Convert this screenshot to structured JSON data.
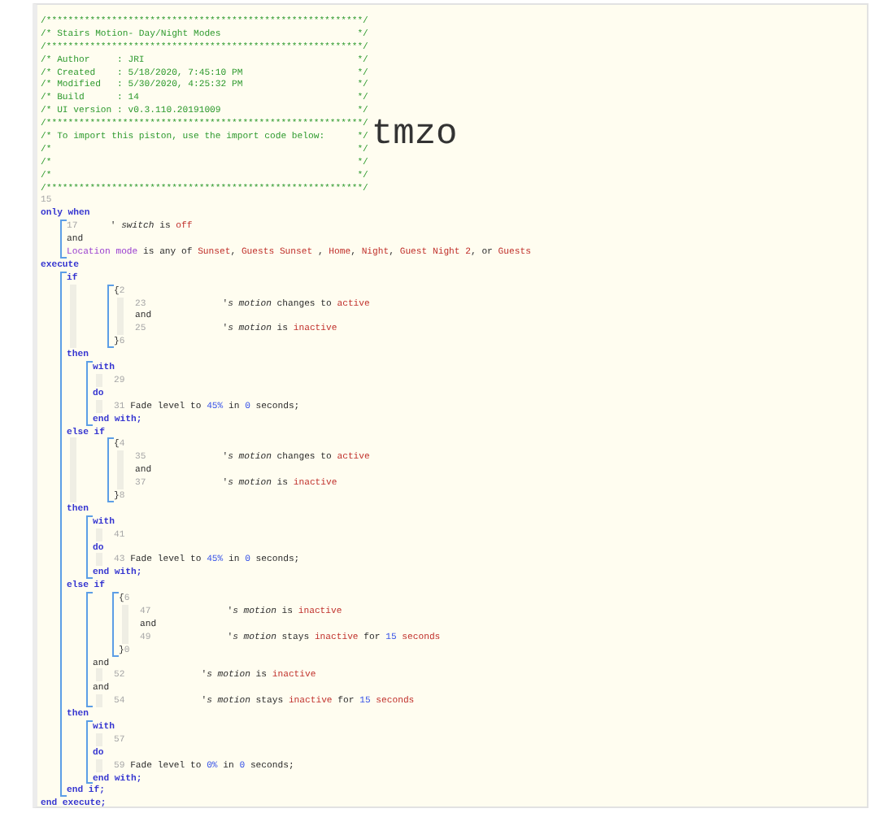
{
  "header": {
    "comment_lines": [
      "/**********************************************************/",
      "/* Stairs Motion- Day/Night Modes                         */",
      "/**********************************************************/",
      "/* Author     : JRI                                       */",
      "/* Created    : 5/18/2020, 7:45:10 PM                     */",
      "/* Modified   : 5/30/2020, 4:25:32 PM                     */",
      "/* Build      : 14                                        */",
      "/* UI version : v0.3.110.20191009                         */",
      "/**********************************************************/",
      "/* To import this piston, use the import code below:      */",
      "/*                                                        */",
      "/*                                                        */",
      "/*                                                        */",
      "/**********************************************************/"
    ],
    "import_code": "tmzo"
  },
  "code": [
    {
      "kind": "line",
      "tokens": [
        {
          "kind": "num",
          "text": "15"
        }
      ]
    },
    {
      "kind": "line",
      "tokens": [
        {
          "kind": "kw",
          "text": "only when"
        }
      ]
    },
    {
      "kind": "block",
      "items": [
        {
          "kind": "line",
          "tokens": [
            {
              "kind": "num",
              "text": "17"
            },
            {
              "kind": "txt",
              "text": "      ' *switch* is "
            },
            {
              "kind": "val",
              "text": "off"
            }
          ]
        },
        {
          "kind": "line",
          "tokens": [
            {
              "kind": "txt",
              "text": "and"
            }
          ]
        },
        {
          "kind": "line",
          "tokens": [
            {
              "kind": "var",
              "text": "Location mode"
            },
            {
              "kind": "txt",
              "text": " is any of "
            },
            {
              "kind": "val",
              "text": "Sunset"
            },
            {
              "kind": "txt",
              "text": ", "
            },
            {
              "kind": "val",
              "text": "Guests Sunset"
            },
            {
              "kind": "txt",
              "text": " , "
            },
            {
              "kind": "val",
              "text": "Home"
            },
            {
              "kind": "txt",
              "text": ", "
            },
            {
              "kind": "val",
              "text": "Night"
            },
            {
              "kind": "txt",
              "text": ", "
            },
            {
              "kind": "val",
              "text": "Guest Night 2"
            },
            {
              "kind": "txt",
              "text": ", or "
            },
            {
              "kind": "val",
              "text": "Guests"
            }
          ]
        }
      ]
    },
    {
      "kind": "line",
      "tokens": [
        {
          "kind": "kw",
          "text": "execute"
        }
      ]
    },
    {
      "kind": "block",
      "items": [
        {
          "kind": "line",
          "tokens": [
            {
              "kind": "kw",
              "text": "if"
            }
          ]
        },
        {
          "kind": "indent",
          "items": [
            {
              "kind": "block",
              "items": [
                {
                  "kind": "line",
                  "tokens": [
                    {
                      "kind": "txt",
                      "text": "{"
                    },
                    {
                      "kind": "num",
                      "text": "2"
                    }
                  ]
                },
                {
                  "kind": "indent",
                  "items": [
                    {
                      "kind": "line",
                      "tokens": [
                        {
                          "kind": "num",
                          "text": "23"
                        },
                        {
                          "kind": "txt",
                          "text": "              '*s motion* changes to "
                        },
                        {
                          "kind": "val",
                          "text": "active"
                        }
                      ]
                    },
                    {
                      "kind": "line",
                      "tokens": [
                        {
                          "kind": "txt",
                          "text": "and"
                        }
                      ]
                    },
                    {
                      "kind": "line",
                      "tokens": [
                        {
                          "kind": "num",
                          "text": "25"
                        },
                        {
                          "kind": "txt",
                          "text": "              '*s motion* is "
                        },
                        {
                          "kind": "val",
                          "text": "inactive"
                        }
                      ]
                    }
                  ]
                },
                {
                  "kind": "line",
                  "tokens": [
                    {
                      "kind": "txt",
                      "text": "}"
                    },
                    {
                      "kind": "num",
                      "text": "6"
                    }
                  ]
                }
              ]
            }
          ]
        },
        {
          "kind": "line",
          "tokens": [
            {
              "kind": "kw",
              "text": "then"
            }
          ]
        },
        {
          "kind": "block",
          "items": [
            {
              "kind": "line",
              "tokens": [
                {
                  "kind": "kw",
                  "text": "with"
                }
              ]
            },
            {
              "kind": "indent",
              "items": [
                {
                  "kind": "line",
                  "tokens": [
                    {
                      "kind": "num",
                      "text": "29"
                    }
                  ]
                }
              ]
            },
            {
              "kind": "line",
              "tokens": [
                {
                  "kind": "kw",
                  "text": "do"
                }
              ]
            },
            {
              "kind": "indent",
              "items": [
                {
                  "kind": "line",
                  "tokens": [
                    {
                      "kind": "num",
                      "text": "31"
                    },
                    {
                      "kind": "txt",
                      "text": " Fade level to "
                    },
                    {
                      "kind": "lit",
                      "text": "45%"
                    },
                    {
                      "kind": "txt",
                      "text": " in "
                    },
                    {
                      "kind": "lit",
                      "text": "0"
                    },
                    {
                      "kind": "txt",
                      "text": " seconds;"
                    }
                  ]
                }
              ]
            },
            {
              "kind": "line",
              "tokens": [
                {
                  "kind": "kw",
                  "text": "end with;"
                }
              ]
            }
          ]
        },
        {
          "kind": "line",
          "tokens": [
            {
              "kind": "kw",
              "text": "else if"
            }
          ]
        },
        {
          "kind": "indent",
          "items": [
            {
              "kind": "block",
              "items": [
                {
                  "kind": "line",
                  "tokens": [
                    {
                      "kind": "txt",
                      "text": "{"
                    },
                    {
                      "kind": "num",
                      "text": "4"
                    }
                  ]
                },
                {
                  "kind": "indent",
                  "items": [
                    {
                      "kind": "line",
                      "tokens": [
                        {
                          "kind": "num",
                          "text": "35"
                        },
                        {
                          "kind": "txt",
                          "text": "              '*s motion* changes to "
                        },
                        {
                          "kind": "val",
                          "text": "active"
                        }
                      ]
                    },
                    {
                      "kind": "line",
                      "tokens": [
                        {
                          "kind": "txt",
                          "text": "and"
                        }
                      ]
                    },
                    {
                      "kind": "line",
                      "tokens": [
                        {
                          "kind": "num",
                          "text": "37"
                        },
                        {
                          "kind": "txt",
                          "text": "              '*s motion* is "
                        },
                        {
                          "kind": "val",
                          "text": "inactive"
                        }
                      ]
                    }
                  ]
                },
                {
                  "kind": "line",
                  "tokens": [
                    {
                      "kind": "txt",
                      "text": "}"
                    },
                    {
                      "kind": "num",
                      "text": "8"
                    }
                  ]
                }
              ]
            }
          ]
        },
        {
          "kind": "line",
          "tokens": [
            {
              "kind": "kw",
              "text": "then"
            }
          ]
        },
        {
          "kind": "block",
          "items": [
            {
              "kind": "line",
              "tokens": [
                {
                  "kind": "kw",
                  "text": "with"
                }
              ]
            },
            {
              "kind": "indent",
              "items": [
                {
                  "kind": "line",
                  "tokens": [
                    {
                      "kind": "num",
                      "text": "41"
                    }
                  ]
                }
              ]
            },
            {
              "kind": "line",
              "tokens": [
                {
                  "kind": "kw",
                  "text": "do"
                }
              ]
            },
            {
              "kind": "indent",
              "items": [
                {
                  "kind": "line",
                  "tokens": [
                    {
                      "kind": "num",
                      "text": "43"
                    },
                    {
                      "kind": "txt",
                      "text": " Fade level to "
                    },
                    {
                      "kind": "lit",
                      "text": "45%"
                    },
                    {
                      "kind": "txt",
                      "text": " in "
                    },
                    {
                      "kind": "lit",
                      "text": "0"
                    },
                    {
                      "kind": "txt",
                      "text": " seconds;"
                    }
                  ]
                }
              ]
            },
            {
              "kind": "line",
              "tokens": [
                {
                  "kind": "kw",
                  "text": "end with;"
                }
              ]
            }
          ]
        },
        {
          "kind": "line",
          "tokens": [
            {
              "kind": "kw",
              "text": "else if"
            }
          ]
        },
        {
          "kind": "block",
          "items": [
            {
              "kind": "block",
              "items": [
                {
                  "kind": "line",
                  "tokens": [
                    {
                      "kind": "txt",
                      "text": "{"
                    },
                    {
                      "kind": "num",
                      "text": "6"
                    }
                  ]
                },
                {
                  "kind": "indent",
                  "items": [
                    {
                      "kind": "line",
                      "tokens": [
                        {
                          "kind": "num",
                          "text": "47"
                        },
                        {
                          "kind": "txt",
                          "text": "              '*s motion* is "
                        },
                        {
                          "kind": "val",
                          "text": "inactive"
                        }
                      ]
                    },
                    {
                      "kind": "line",
                      "tokens": [
                        {
                          "kind": "txt",
                          "text": "and"
                        }
                      ]
                    },
                    {
                      "kind": "line",
                      "tokens": [
                        {
                          "kind": "num",
                          "text": "49"
                        },
                        {
                          "kind": "txt",
                          "text": "              '*s motion* stays "
                        },
                        {
                          "kind": "val",
                          "text": "inactive"
                        },
                        {
                          "kind": "txt",
                          "text": " for "
                        },
                        {
                          "kind": "lit",
                          "text": "15"
                        },
                        {
                          "kind": "val",
                          "text": " seconds"
                        }
                      ]
                    }
                  ]
                },
                {
                  "kind": "line",
                  "tokens": [
                    {
                      "kind": "txt",
                      "text": "}"
                    },
                    {
                      "kind": "num",
                      "text": "0"
                    }
                  ]
                }
              ]
            },
            {
              "kind": "line",
              "tokens": [
                {
                  "kind": "txt",
                  "text": "and"
                }
              ]
            },
            {
              "kind": "indent",
              "items": [
                {
                  "kind": "line",
                  "tokens": [
                    {
                      "kind": "num",
                      "text": "52"
                    },
                    {
                      "kind": "txt",
                      "text": "              '*s motion* is "
                    },
                    {
                      "kind": "val",
                      "text": "inactive"
                    }
                  ]
                }
              ]
            },
            {
              "kind": "line",
              "tokens": [
                {
                  "kind": "txt",
                  "text": "and"
                }
              ]
            },
            {
              "kind": "indent",
              "items": [
                {
                  "kind": "line",
                  "tokens": [
                    {
                      "kind": "num",
                      "text": "54"
                    },
                    {
                      "kind": "txt",
                      "text": "              '*s motion* stays "
                    },
                    {
                      "kind": "val",
                      "text": "inactive"
                    },
                    {
                      "kind": "txt",
                      "text": " for "
                    },
                    {
                      "kind": "lit",
                      "text": "15"
                    },
                    {
                      "kind": "val",
                      "text": " seconds"
                    }
                  ]
                }
              ]
            }
          ]
        },
        {
          "kind": "line",
          "tokens": [
            {
              "kind": "kw",
              "text": "then"
            }
          ]
        },
        {
          "kind": "block",
          "items": [
            {
              "kind": "line",
              "tokens": [
                {
                  "kind": "kw",
                  "text": "with"
                }
              ]
            },
            {
              "kind": "indent",
              "items": [
                {
                  "kind": "line",
                  "tokens": [
                    {
                      "kind": "num",
                      "text": "57"
                    }
                  ]
                }
              ]
            },
            {
              "kind": "line",
              "tokens": [
                {
                  "kind": "kw",
                  "text": "do"
                }
              ]
            },
            {
              "kind": "indent",
              "items": [
                {
                  "kind": "line",
                  "tokens": [
                    {
                      "kind": "num",
                      "text": "59"
                    },
                    {
                      "kind": "txt",
                      "text": " Fade level to "
                    },
                    {
                      "kind": "lit",
                      "text": "0%"
                    },
                    {
                      "kind": "txt",
                      "text": " in "
                    },
                    {
                      "kind": "lit",
                      "text": "0"
                    },
                    {
                      "kind": "txt",
                      "text": " seconds;"
                    }
                  ]
                }
              ]
            },
            {
              "kind": "line",
              "tokens": [
                {
                  "kind": "kw",
                  "text": "end with;"
                }
              ]
            }
          ]
        },
        {
          "kind": "line",
          "tokens": [
            {
              "kind": "kw",
              "text": "end if;"
            }
          ]
        }
      ]
    },
    {
      "kind": "line",
      "tokens": [
        {
          "kind": "kw",
          "text": "end execute;"
        }
      ]
    }
  ]
}
